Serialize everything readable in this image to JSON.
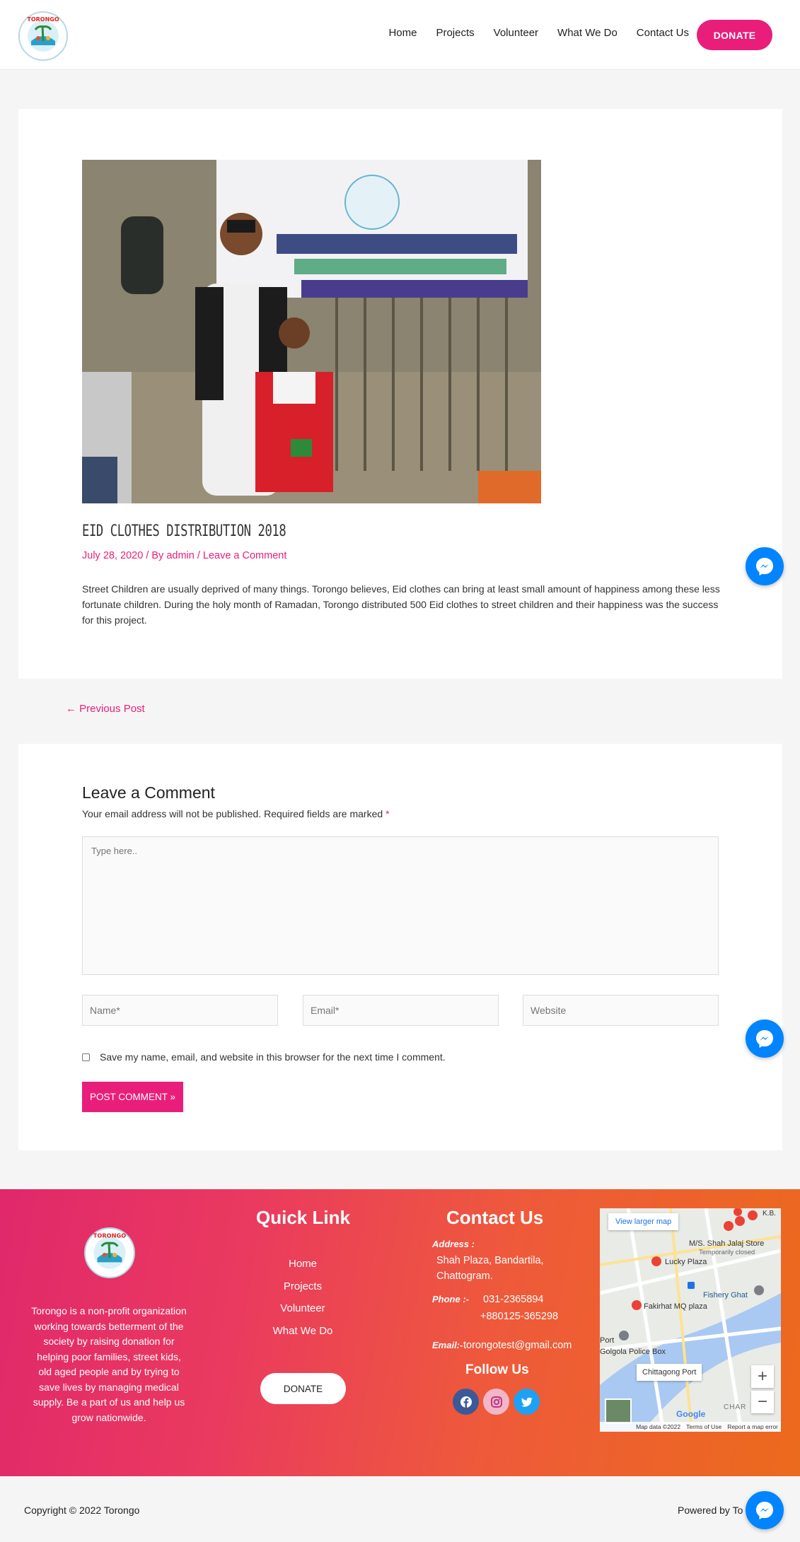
{
  "header": {
    "nav": [
      "Home",
      "Projects",
      "Volunteer",
      "What We Do",
      "Contact Us"
    ],
    "donate_label": "DONATE"
  },
  "post": {
    "title": "EID CLOTHES DISTRIBUTION 2018",
    "date": "July 28, 2020",
    "by": " / By ",
    "author": "admin",
    "comment_link": " / Leave a Comment",
    "body": "Street Children are usually deprived of many things. Torongo believes, Eid clothes can bring at least small amount of happiness among these less fortunate children. During the holy month of Ramadan, Torongo distributed 500 Eid clothes to street children and their happiness was the success for this project."
  },
  "nav_links": {
    "previous": "← Previous Post"
  },
  "comment": {
    "title": "Leave a Comment",
    "note": "Your email address will not be published. Required fields are marked ",
    "required_mark": "*",
    "textarea_placeholder": "Type here..",
    "name_placeholder": "Name*",
    "email_placeholder": "Email*",
    "website_placeholder": "Website",
    "save_label": "Save my name, email, and website in this browser for the next time I comment.",
    "submit_label": "POST COMMENT »"
  },
  "footer": {
    "about": "Torongo is a non-profit organization working towards betterment of the society by raising donation for helping poor families, street kids, old aged people and by trying to save lives by managing medical supply. Be a part of us and help us grow nationwide.",
    "quick_link_title": "Quick Link",
    "quick_links": [
      "Home",
      "Projects",
      "Volunteer",
      "What We Do"
    ],
    "donate_label": "DONATE",
    "contact_title": "Contact Us",
    "address_label": "Address :",
    "address_line1": "Shah Plaza, Bandartila,",
    "address_line2": "Chattogram.",
    "phone_label": "Phone :-",
    "phone1": "031-2365894",
    "phone2": "+880125-365298",
    "email_label": "Email:-",
    "email": "torongotest@gmail.com",
    "follow_title": "Follow Us",
    "map": {
      "view_larger": "View larger map",
      "places": [
        "M/S. Shah Jalaj Store",
        "Temporarily closed",
        "Lucky Plaza",
        "Fishery Ghat",
        "Fakirhat MQ plaza",
        "Golgola Police Box",
        "Chittagong Port",
        "Port",
        "K.B.",
        "CHAR"
      ],
      "footer_items": [
        "Map data ©2022",
        "Terms of Use",
        "Report a map error"
      ]
    }
  },
  "bottom": {
    "copyright": "Copyright © 2022 Torongo",
    "powered": "Powered by To"
  },
  "colors": {
    "accent": "#e91e7a",
    "messenger": "#0084ff"
  }
}
